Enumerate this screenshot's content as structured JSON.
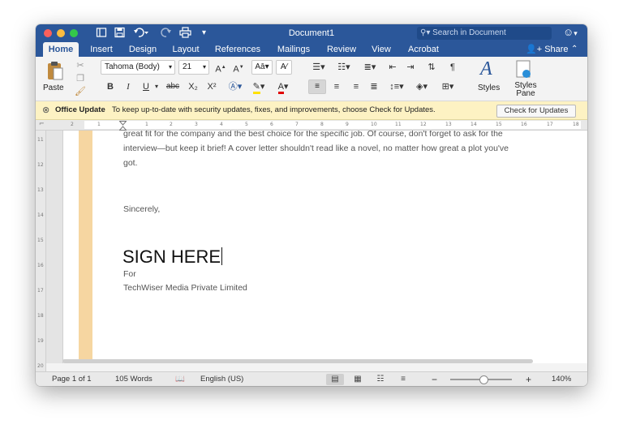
{
  "window": {
    "title": "Document1",
    "search_placeholder": "Search in Document",
    "share_label": "Share"
  },
  "tabs": [
    {
      "label": "Home",
      "active": true
    },
    {
      "label": "Insert"
    },
    {
      "label": "Design"
    },
    {
      "label": "Layout"
    },
    {
      "label": "References"
    },
    {
      "label": "Mailings"
    },
    {
      "label": "Review"
    },
    {
      "label": "View"
    },
    {
      "label": "Acrobat"
    }
  ],
  "ribbon": {
    "paste_label": "Paste",
    "font_name": "Tahoma (Body)",
    "font_size": "21",
    "bold": "B",
    "italic": "I",
    "underline": "U",
    "strikethrough": "abc",
    "subscript": "X₂",
    "superscript": "X²",
    "styles_label": "Styles",
    "styles_pane_label": "Styles Pane"
  },
  "update_bar": {
    "title": "Office Update",
    "message": "To keep up-to-date with security updates, fixes, and improvements, choose Check for Updates.",
    "button": "Check for Updates"
  },
  "ruler": {
    "h_ticks": [
      "2",
      "1",
      "1",
      "2",
      "3",
      "4",
      "5",
      "6",
      "7",
      "8",
      "9",
      "10",
      "11",
      "12",
      "13",
      "14",
      "15",
      "16",
      "17",
      "18"
    ],
    "v_ticks": [
      "11",
      "12",
      "13",
      "14",
      "15",
      "16",
      "17",
      "18",
      "19",
      "20"
    ]
  },
  "document": {
    "paragraph_line1": "great fit for the company and the best choice for the specific job. Of course, don't forget to ask for the",
    "paragraph_line2": "interview—but keep it brief! A cover letter shouldn't read like a novel, no matter how great a plot you've",
    "paragraph_line3": "got.",
    "closing": "Sincerely,",
    "signature": "SIGN HERE",
    "for_label": "For",
    "company": "TechWiser Media Private Limited"
  },
  "status": {
    "page": "Page 1 of 1",
    "words": "105 Words",
    "language": "English (US)",
    "zoom": "140%",
    "zoom_fraction": 0.55
  },
  "colors": {
    "accent": "#2b579a",
    "update_bar": "#fdf2c3",
    "margin_strip": "#f6d6a1"
  }
}
